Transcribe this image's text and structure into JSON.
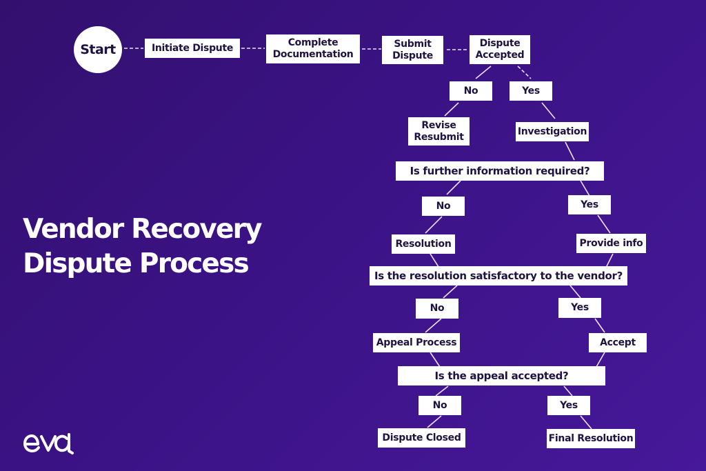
{
  "title": {
    "line1": "Vendor Recovery",
    "line2": "Dispute Process"
  },
  "brand": {
    "logo_text": "eva",
    "background_color": "#3a1283",
    "node_color": "#ffffff",
    "text_color": "#1e1240"
  },
  "flow": {
    "start": "Start",
    "initiate": "Initiate Dispute",
    "complete_doc_1": "Complete",
    "complete_doc_2": "Documentation",
    "submit_1": "Submit",
    "submit_2": "Dispute",
    "accepted_1": "Dispute",
    "accepted_2": "Accepted",
    "accepted_no": "No",
    "accepted_yes": "Yes",
    "revise_1": "Revise",
    "revise_2": "Resubmit",
    "investigation": "Investigation",
    "q_further_info": "Is further information required?",
    "info_no": "No",
    "info_yes": "Yes",
    "resolution": "Resolution",
    "provide_info": "Provide info",
    "q_satisfactory": "Is the resolution satisfactory to the vendor?",
    "satisfactory_no": "No",
    "satisfactory_yes": "Yes",
    "appeal_process": "Appeal Process",
    "accept": "Accept",
    "q_appeal": "Is the appeal accepted?",
    "appeal_no": "No",
    "appeal_yes": "Yes",
    "dispute_closed": "Dispute Closed",
    "final_resolution": "Final Resolution"
  }
}
